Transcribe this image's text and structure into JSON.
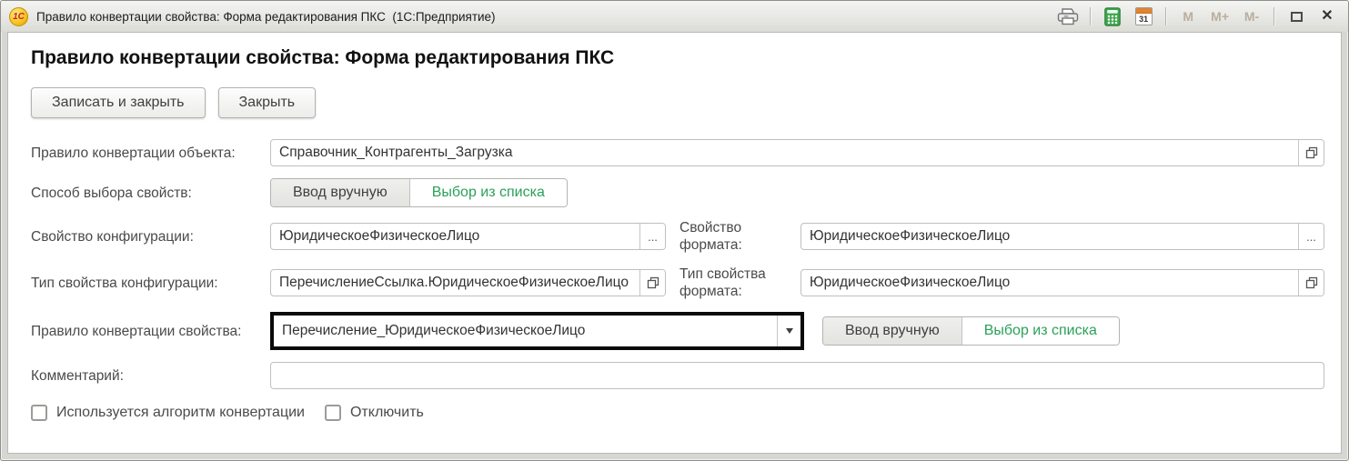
{
  "window": {
    "title": "Правило конвертации свойства: Форма редактирования ПКС  (1С:Предприятие)",
    "logo_text": "1С",
    "calendar_day": "31",
    "memory_buttons": [
      "M",
      "M+",
      "M-"
    ]
  },
  "heading": "Правило конвертации свойства: Форма редактирования ПКС",
  "toolbar": {
    "save_and_close": "Записать и закрыть",
    "close": "Закрыть"
  },
  "form": {
    "object_rule_label": "Правило конвертации объекта:",
    "object_rule_value": "Справочник_Контрагенты_Загрузка",
    "selection_method_label": "Способ выбора свойств:",
    "manual_input": "Ввод вручную",
    "select_from_list": "Выбор из списка",
    "config_property_label": "Свойство конфигурации:",
    "config_property_value": "ЮридическоеФизическоеЛицо",
    "format_property_label": "Свойство формата:",
    "format_property_value": "ЮридическоеФизическоеЛицо",
    "config_property_type_label": "Тип свойства конфигурации:",
    "config_property_type_value": "ПеречислениеСсылка.ЮридическоеФизическоеЛицо",
    "format_property_type_label": "Тип свойства формата:",
    "format_property_type_value": "ЮридическоеФизическоеЛицо",
    "property_rule_label": "Правило конвертации свойства:",
    "property_rule_value": "Перечисление_ЮридическоеФизическоеЛицо",
    "property_manual_input": "Ввод вручную",
    "property_select_from_list": "Выбор из списка",
    "comment_label": "Комментарий:",
    "comment_value": "",
    "ellipsis_button": "...",
    "algorithm_checkbox_label": "Используется алгоритм конвертации",
    "disable_checkbox_label": "Отключить"
  },
  "colors": {
    "accent_green": "#2aa158",
    "highlight_border": "#0a0a0a",
    "calendar_orange": "#e2832f"
  }
}
